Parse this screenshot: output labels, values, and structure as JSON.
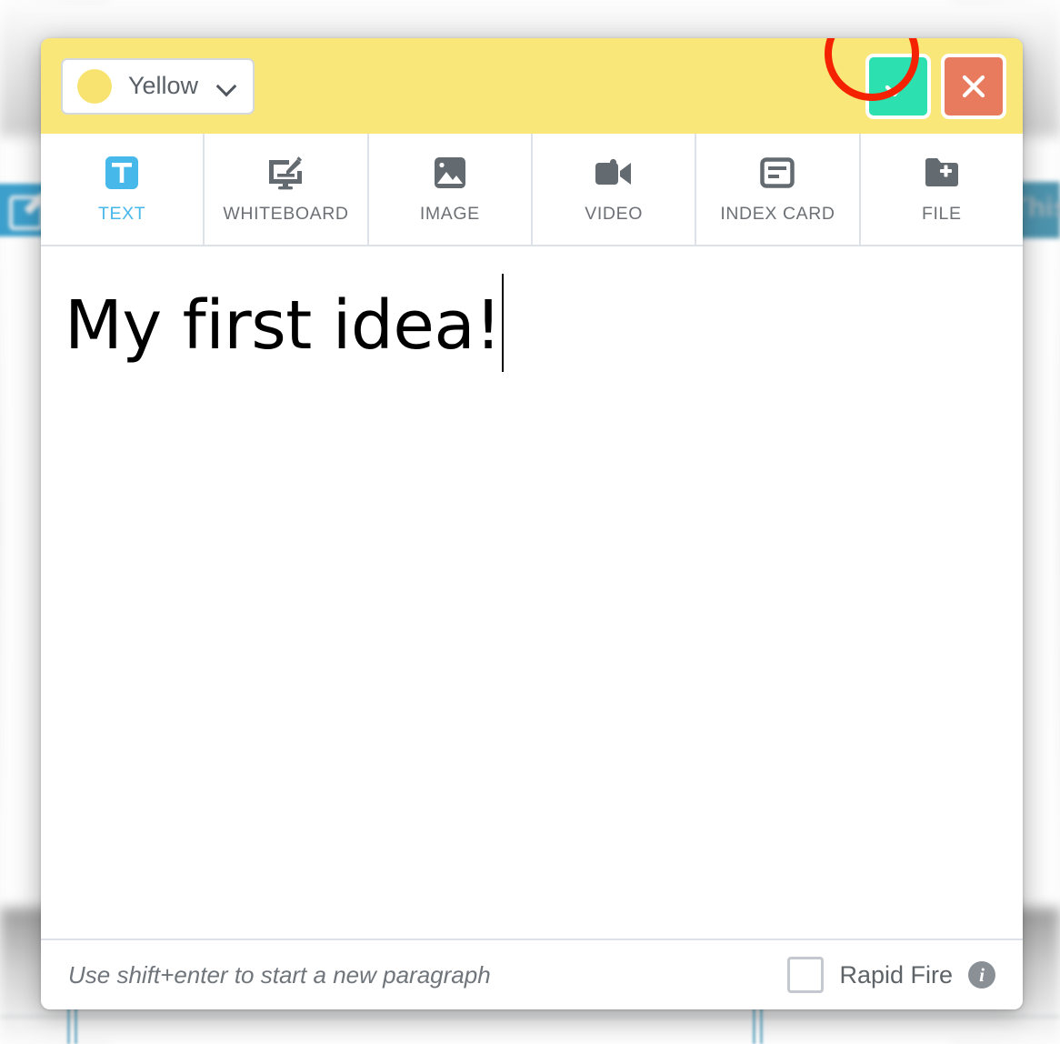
{
  "background": {
    "left_widget_icon": "edit-pencil-icon",
    "right_banner_text": "This"
  },
  "modal": {
    "header": {
      "color_selector": {
        "swatch_color": "#f8e371",
        "value": "Yellow",
        "chevron_icon": "chevron-down-icon"
      },
      "background_color": "#f9e879",
      "confirm_label": "✓",
      "cancel_label": "✕",
      "confirm_color": "#2ce0b0",
      "cancel_color": "#e87a5d"
    },
    "annotation": {
      "shape": "circle",
      "color": "#f42200",
      "target": "confirm-button"
    },
    "tabs": [
      {
        "label": "TEXT",
        "icon": "text-t-icon",
        "active": true
      },
      {
        "label": "WHITEBOARD",
        "icon": "whiteboard-icon",
        "active": false
      },
      {
        "label": "IMAGE",
        "icon": "image-icon",
        "active": false
      },
      {
        "label": "VIDEO",
        "icon": "video-camera-icon",
        "active": false
      },
      {
        "label": "INDEX CARD",
        "icon": "index-card-icon",
        "active": false
      },
      {
        "label": "FILE",
        "icon": "file-add-icon",
        "active": false
      }
    ],
    "active_tab_color": "#46b8e9",
    "editor": {
      "text": "My first idea!",
      "caret_visible": true
    },
    "footer": {
      "hint": "Use shift+enter to start a new paragraph",
      "rapid_fire_label": "Rapid Fire",
      "rapid_fire_checked": false,
      "info_icon": "info-icon",
      "info_glyph": "i"
    }
  }
}
